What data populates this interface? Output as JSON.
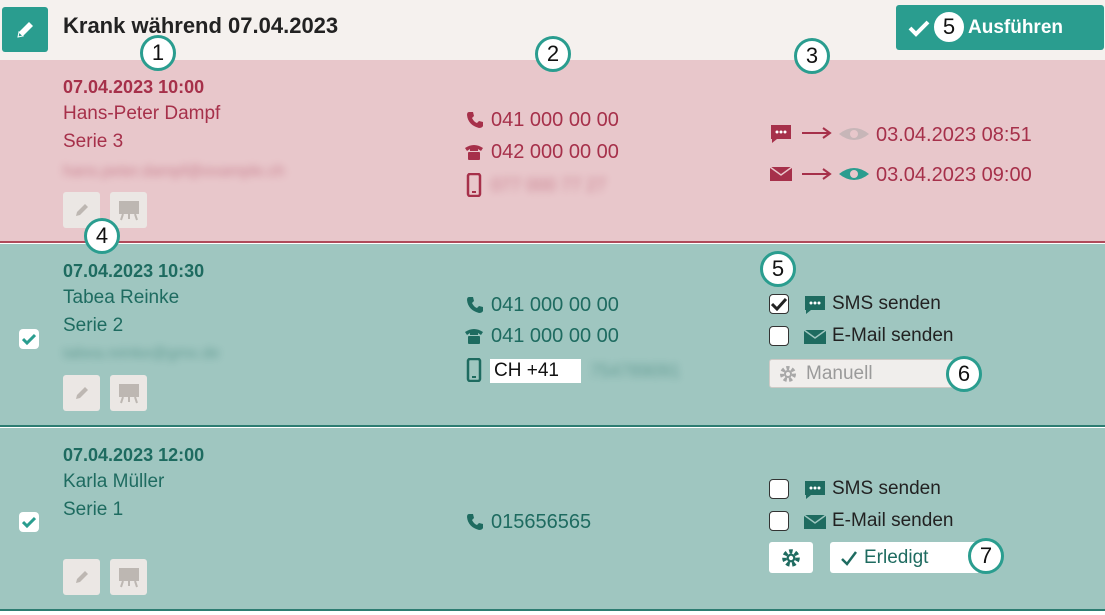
{
  "header": {
    "title": "Krank während 07.04.2023",
    "execute_label": "Ausführen"
  },
  "colors": {
    "accent": "#2a9d8f",
    "red_row": "#e8c7cb",
    "teal_row": "#9fc6c0",
    "red_text": "#a6304a",
    "teal_text": "#1e6b60"
  },
  "rows": [
    {
      "datetime": "07.04.2023 10:00",
      "name": "Hans-Peter Dampf",
      "series": "Serie 3",
      "email_blurred": "hans.peter.dampf@example.ch",
      "phones": {
        "phone": "041 000 00 00",
        "landline": "042 000 00 00",
        "mobile_blurred": "077 000 77 27"
      },
      "sent": [
        {
          "channel": "sms",
          "timestamp": "03.04.2023 08:51",
          "seen": false
        },
        {
          "channel": "email",
          "timestamp": "03.04.2023 09:00",
          "seen": true
        }
      ]
    },
    {
      "datetime": "07.04.2023 10:30",
      "name": "Tabea Reinke",
      "series": "Serie 2",
      "email_blurred": "tabea.reinke@gmx.de",
      "selected": true,
      "phones": {
        "phone": "041 000 00 00",
        "landline": "041 000 00 00",
        "mobile_prefix": "CH +41",
        "mobile_blurred": "754789091"
      },
      "options": {
        "sms_label": "SMS senden",
        "sms_checked": true,
        "email_label": "E-Mail senden",
        "email_checked": false
      },
      "mode_select": "Manuell"
    },
    {
      "datetime": "07.04.2023 12:00",
      "name": "Karla Müller",
      "series": "Serie 1",
      "selected": true,
      "phones": {
        "phone": "015656565"
      },
      "options": {
        "sms_label": "SMS senden",
        "sms_checked": false,
        "email_label": "E-Mail senden",
        "email_checked": false
      },
      "done_label": "Erledigt"
    }
  ],
  "callouts": [
    "1",
    "2",
    "3",
    "4",
    "5",
    "5",
    "6",
    "7"
  ],
  "icons": [
    "pencil-icon",
    "checkmark-icon",
    "phone-icon",
    "landline-icon",
    "mobile-icon",
    "sms-icon",
    "mail-icon",
    "arrow-right-icon",
    "eye-icon",
    "whiteboard-icon",
    "gear-icon"
  ]
}
